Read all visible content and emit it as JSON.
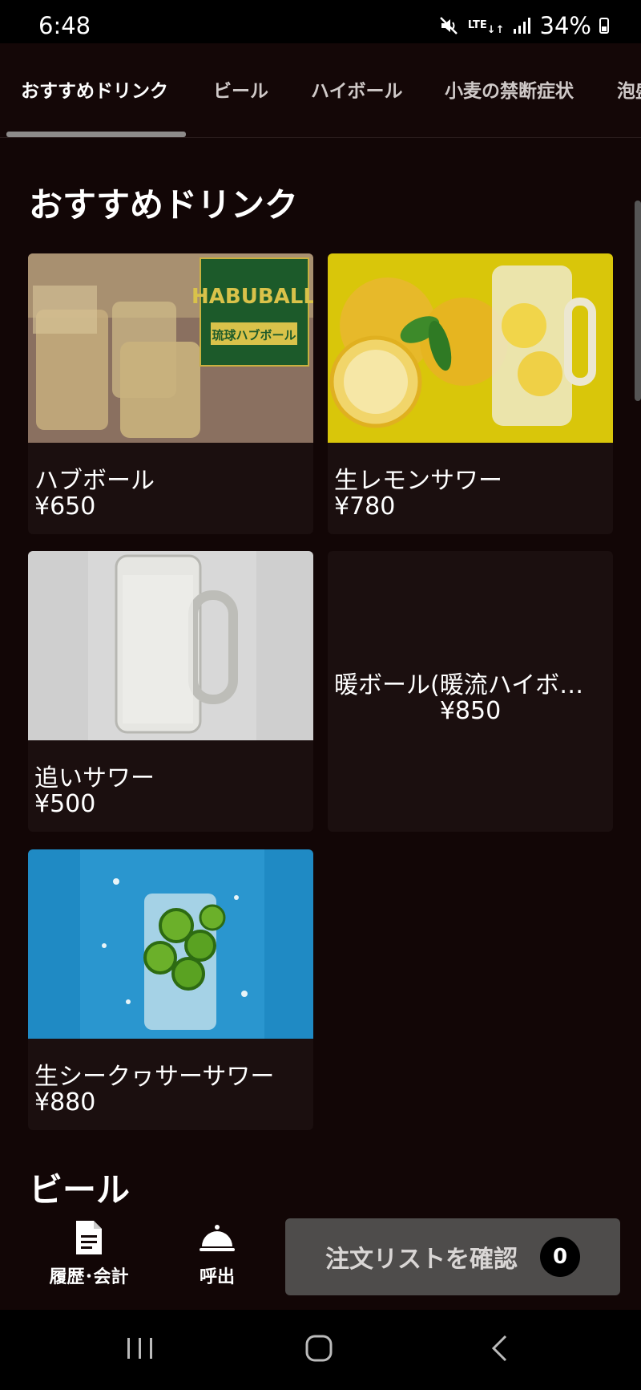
{
  "status_bar": {
    "time": "6:48",
    "network": "LTE",
    "battery": "34%"
  },
  "tabs": [
    {
      "label": "おすすめドリンク"
    },
    {
      "label": "ビール"
    },
    {
      "label": "ハイボール"
    },
    {
      "label": "小麦の禁断症状"
    },
    {
      "label": "泡盛"
    }
  ],
  "sections": [
    {
      "title": "おすすめドリンク",
      "items": [
        {
          "name": "ハブボール",
          "price": "¥650",
          "image_text_1": "HABUBALL",
          "image_text_2": "琉球ハブボール"
        },
        {
          "name": "生レモンサワー",
          "price": "¥780"
        },
        {
          "name": "追いサワー",
          "price": "¥500"
        },
        {
          "name": "暖ボール(暖流ハイボー…",
          "price": "¥850"
        },
        {
          "name": "生シークヮサーサワー",
          "price": "¥880"
        }
      ]
    },
    {
      "title": "ビール"
    }
  ],
  "bottom": {
    "history_label": "履歴･会計",
    "call_label": "呼出",
    "order_label": "注文リストを確認",
    "order_count": "0"
  },
  "colors": {
    "background": "#120606",
    "card": "#1b0f0f",
    "order_button": "#4e4c4b"
  }
}
